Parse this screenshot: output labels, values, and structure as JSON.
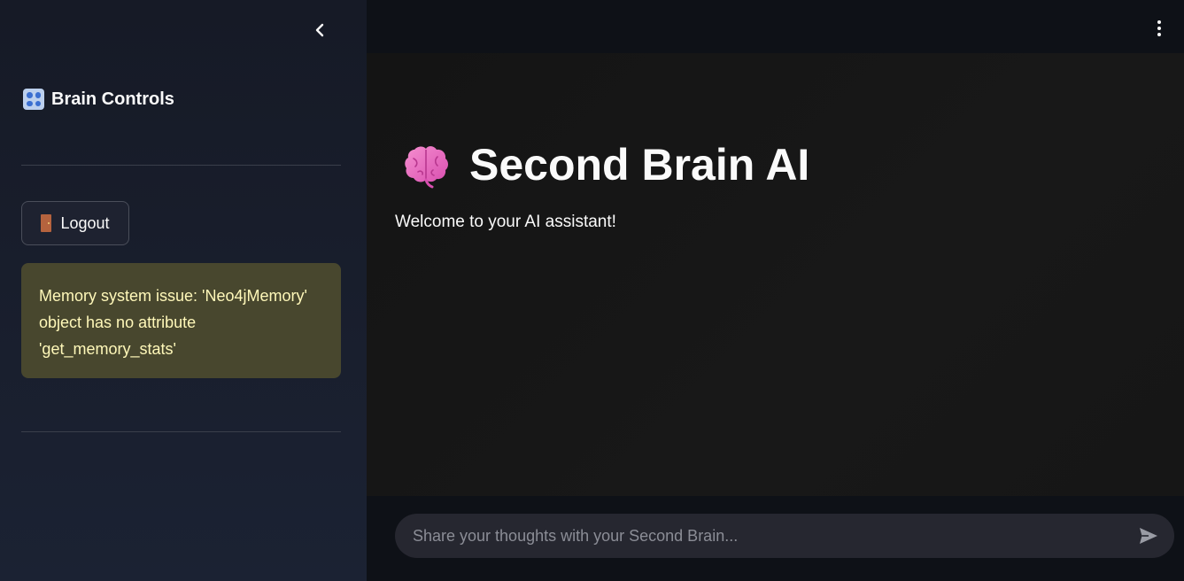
{
  "sidebar": {
    "collapse_icon": "chevron-left-icon",
    "title": "Brain Controls",
    "title_icon": "control-knobs-icon",
    "logout_label": "Logout",
    "logout_icon": "door-icon",
    "warning": {
      "text": "Memory system issue: 'Neo4jMemory' object has no attribute 'get_memory_stats'",
      "color": "#fff8b9",
      "background": "#48472e"
    }
  },
  "header": {
    "menu_icon": "more-vertical-icon"
  },
  "main": {
    "title": "Second Brain AI",
    "title_icon": "brain-icon",
    "welcome": "Welcome to your AI assistant!"
  },
  "chat": {
    "placeholder": "Share your thoughts with your Second Brain...",
    "value": "",
    "send_icon": "send-icon"
  },
  "colors": {
    "sidebar_bg": "#1b2233",
    "main_bg": "#0e1117",
    "content_bg": "#161616",
    "input_bg": "#262730"
  }
}
